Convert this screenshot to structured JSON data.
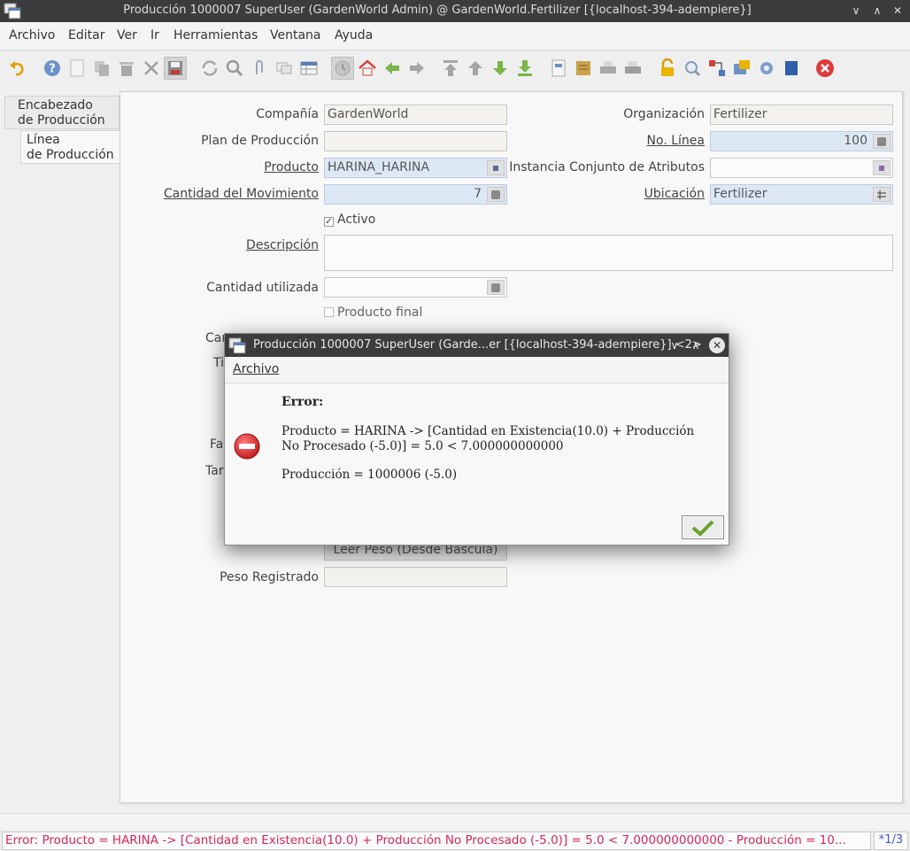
{
  "window": {
    "title": "Producción 1000007 SuperUser (GardenWorld Admin) @ GardenWorld.Fertilizer [{localhost-394-adempiere}]"
  },
  "menu": {
    "items": [
      "Archivo",
      "Editar",
      "Ver",
      "Ir",
      "Herramientas",
      "Ventana",
      "Ayuda"
    ]
  },
  "tabs": {
    "header": [
      "Encabezado",
      "de Producción"
    ],
    "line": [
      "Línea",
      "de Producción"
    ]
  },
  "form": {
    "company_label": "Compañía",
    "company_value": "GardenWorld",
    "org_label": "Organización",
    "org_value": "Fertilizer",
    "plan_label": "Plan de Producción",
    "plan_value": "",
    "line_no_label": "No. Línea",
    "line_no_value": "100",
    "product_label": "Producto",
    "product_value": "HARINA_HARINA",
    "asi_label": "Instancia Conjunto de Atributos",
    "asi_value": "",
    "qty_label": "Cantidad del Movimiento",
    "qty_value": "7",
    "locator_label": "Ubicación",
    "locator_value": "Fertilizer",
    "active_label": "Activo",
    "description_label": "Descripción",
    "description_value": "",
    "qty_used_label": "Cantidad utilizada",
    "qty_used_value": "",
    "end_product_label": "Producto final",
    "partial_1": "Car",
    "partial_2": "Ti",
    "partial_3": "Fa",
    "partial_4": "Tar",
    "read_weight_button": "Leer Peso (Desde Bascula)",
    "weight_label": "Peso Registrado",
    "weight_value": ""
  },
  "dialog": {
    "title": "Producción 1000007 SuperUser (Garde...er [{localhost-394-adempiere}] <2>",
    "menu_label": "Archivo",
    "heading": "Error:",
    "message_line1": "Producto = HARINA -> [Cantidad en Existencia(10.0) + Producción",
    "message_line2": "No Procesado (-5.0)] = 5.0 < 7.000000000000",
    "message_line3": "Producción = 1000006 (-5.0)"
  },
  "status": {
    "message": "Error: Producto = HARINA -> [Cantidad en Existencia(10.0) + Producción No Procesado (-5.0)] = 5.0 < 7.000000000000 - Producción = 10...",
    "record_count": "*1/3"
  }
}
